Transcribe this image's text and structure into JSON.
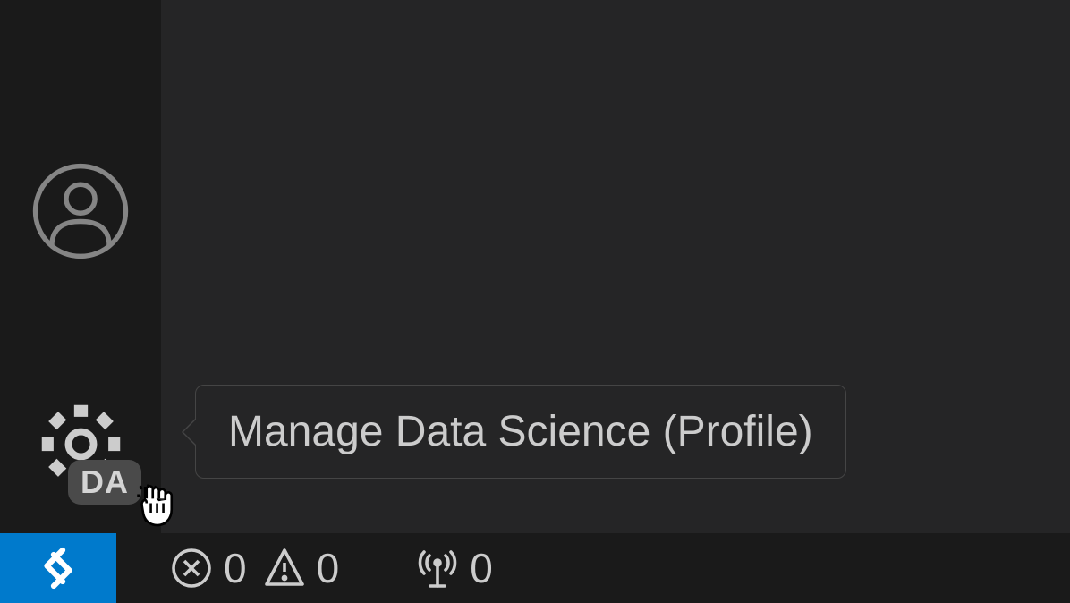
{
  "activityBar": {
    "gearBadge": "DA"
  },
  "tooltip": {
    "text": "Manage Data Science (Profile)"
  },
  "statusBar": {
    "errors": "0",
    "warnings": "0",
    "ports": "0"
  }
}
